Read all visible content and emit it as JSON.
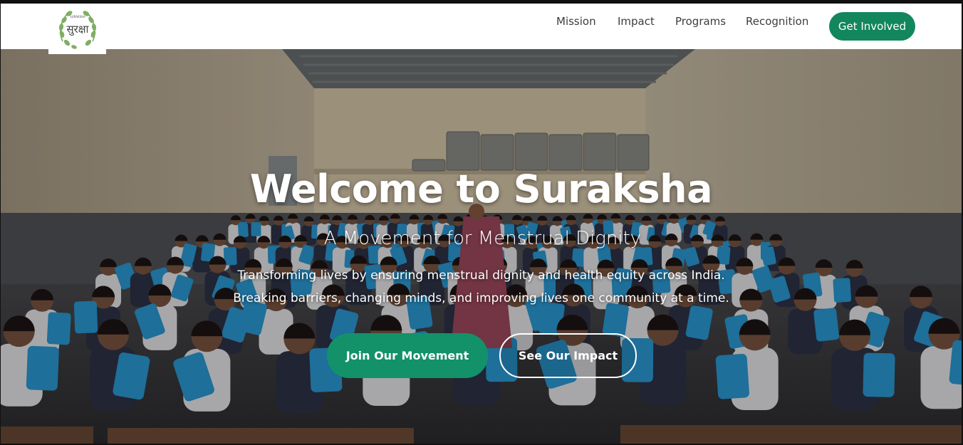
{
  "nav": {
    "logo_text": "सुरक्षा",
    "logo_small": "SURAKSHA",
    "links": [
      "Mission",
      "Impact",
      "Programs",
      "Recognition"
    ],
    "cta": "Get Involved"
  },
  "hero": {
    "title": "Welcome to Suraksha",
    "subtitle": "A Movement for Menstrual Dignity",
    "line1": "Transforming lives by ensuring menstrual dignity and health equity across India.",
    "line2": "Breaking barriers, changing minds, and improving lives one community at a time.",
    "primary_button": "Join Our Movement",
    "secondary_button": "See Our Impact"
  },
  "colors": {
    "brand_green": "#12865d",
    "button_green": "#13926a"
  },
  "icons": [
    "leaf-wreath-logo-icon"
  ]
}
